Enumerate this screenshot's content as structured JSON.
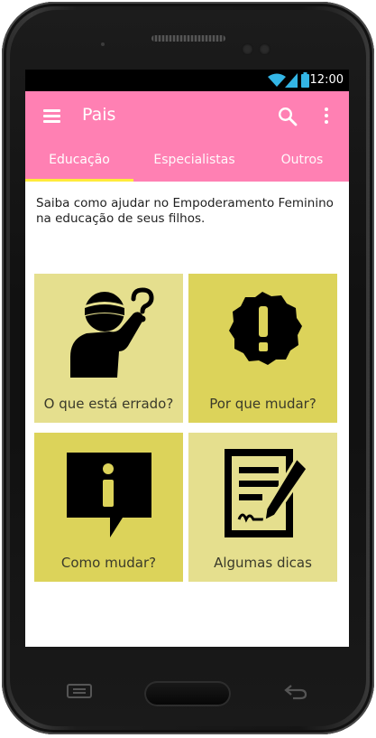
{
  "status_bar": {
    "time": "12:00"
  },
  "app_bar": {
    "title": "Pais",
    "menu_icon": "hamburger-menu-icon",
    "search_icon": "search-icon",
    "more_icon": "more-vert-icon"
  },
  "tabs": [
    {
      "label": "Educação",
      "selected": true
    },
    {
      "label": "Especialistas",
      "selected": false
    },
    {
      "label": "Outros",
      "selected": false
    }
  ],
  "description": "Saiba como ajudar no Empoderamento Feminino na educação de seus filhos.",
  "cards": [
    {
      "label": "O que está errado?",
      "icon": "confused-person-icon",
      "color": "#e5df8e"
    },
    {
      "label": "Por que mudar?",
      "icon": "exclamation-badge-icon",
      "color": "#dcd35a"
    },
    {
      "label": "Como mudar?",
      "icon": "info-speech-bubble-icon",
      "color": "#dcd35a"
    },
    {
      "label": "Algumas dicas",
      "icon": "document-pen-icon",
      "color": "#e5df8e"
    }
  ],
  "colors": {
    "primary": "#ff80b3",
    "accent": "#ffeb3b"
  }
}
